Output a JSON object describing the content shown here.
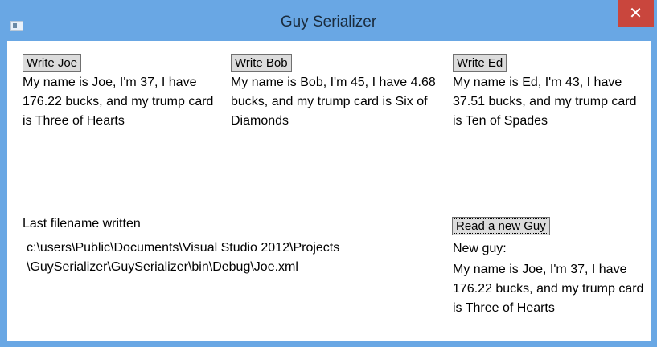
{
  "window": {
    "title": "Guy Serializer",
    "close_glyph": "✕"
  },
  "guys": {
    "joe": {
      "button_label": "Write Joe",
      "description": "My name is Joe, I'm 37, I have 176.22 bucks, and my trump card is Three of Hearts"
    },
    "bob": {
      "button_label": "Write Bob",
      "description": "My name is Bob, I'm 45, I have 4.68 bucks, and my trump card is Six of Diamonds"
    },
    "ed": {
      "button_label": "Write Ed",
      "description": "My name is Ed, I'm 43, I have 37.51 bucks, and my trump card is Ten of Spades"
    }
  },
  "last_file": {
    "label": "Last filename written",
    "value": "c:\\users\\Public\\Documents\\Visual Studio 2012\\Projects\n\\GuySerializer\\GuySerializer\\bin\\Debug\\Joe.xml"
  },
  "read": {
    "button_label": "Read a new Guy",
    "new_guy_label": "New guy:",
    "new_guy_description": "My name is Joe, I'm 37, I have 176.22 bucks, and my trump card is Three of Hearts"
  },
  "colors": {
    "title_bar": "#69a7e4",
    "close_button": "#c9463d"
  }
}
